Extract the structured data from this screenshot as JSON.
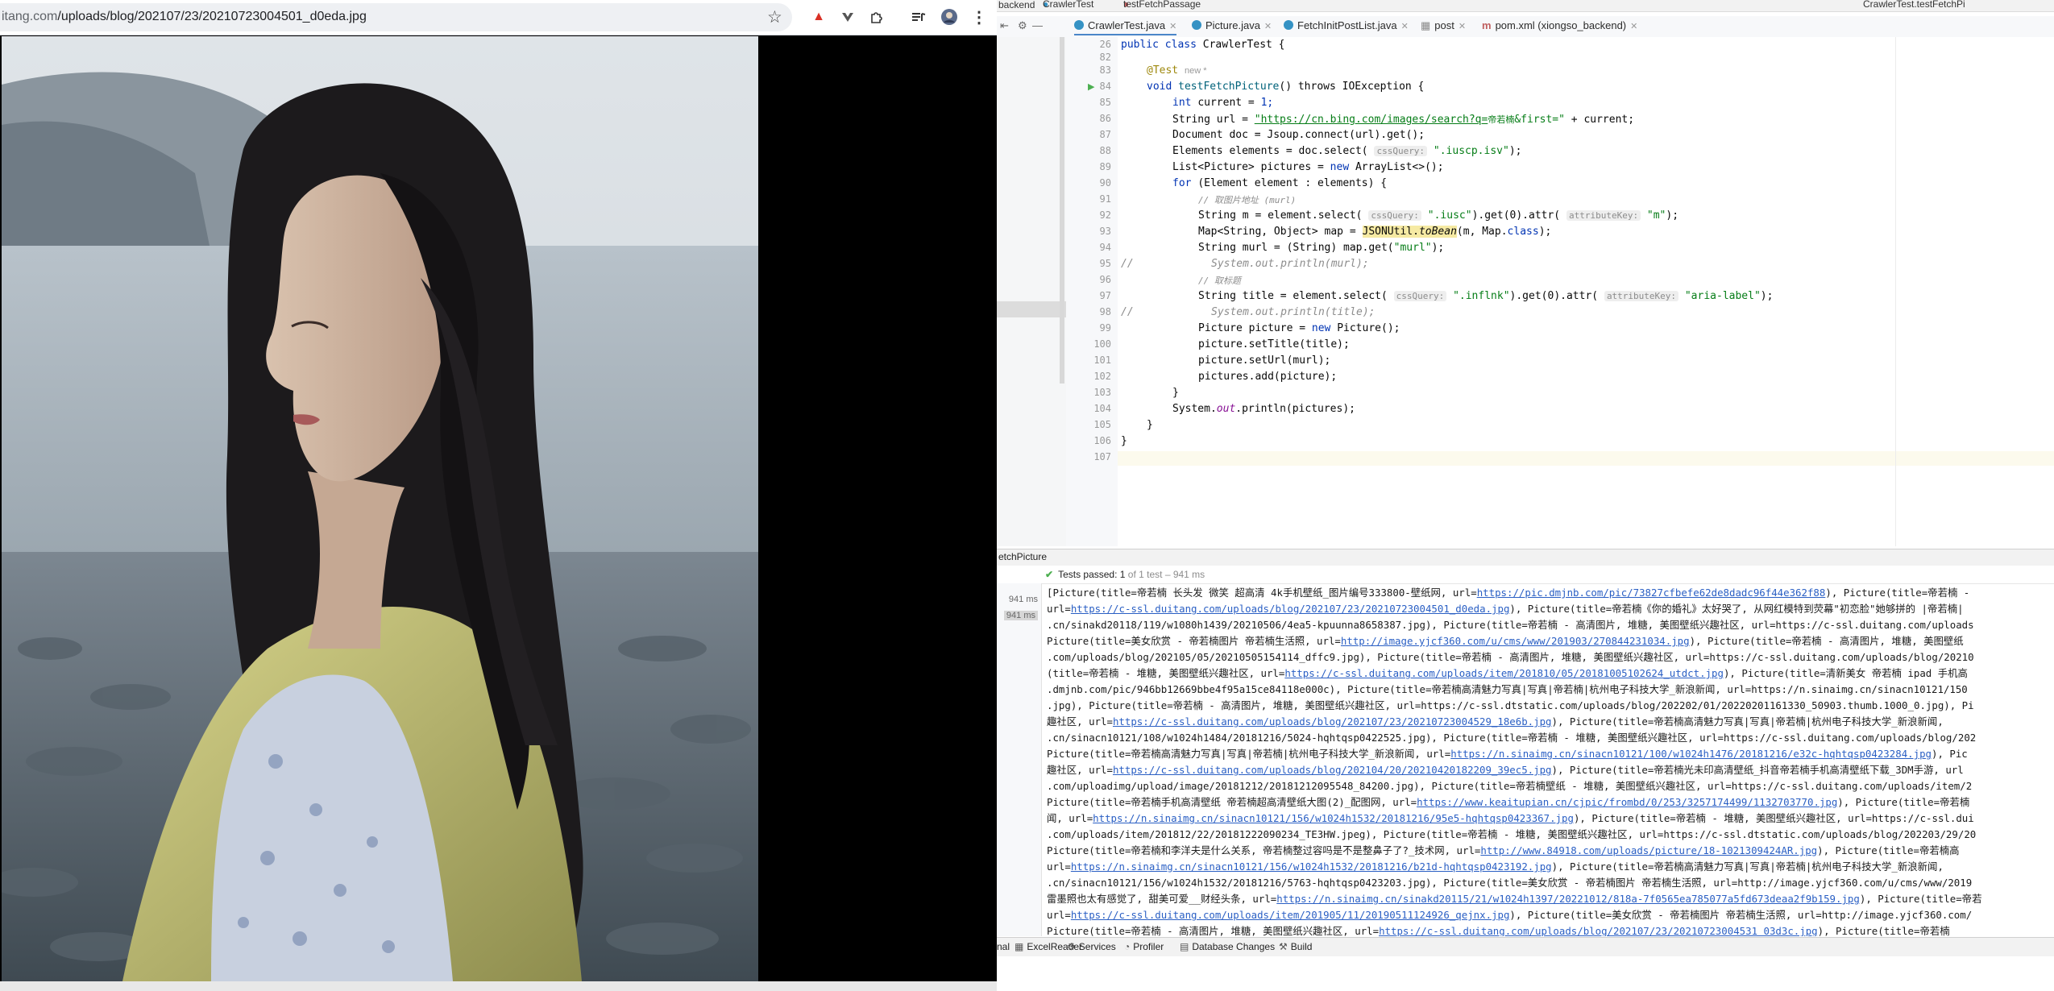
{
  "browser": {
    "url_host": "itang.com",
    "url_path": "/uploads/blog/202107/23/20210723004501_d0eda.jpg",
    "icons": [
      "bookmark-star-icon",
      "ext-red-icon",
      "ext-shield-icon",
      "extensions-puzzle-icon",
      "media-control-icon",
      "profile-avatar-icon",
      "more-menu-icon"
    ]
  },
  "ide": {
    "top_crumbs": [
      "backend",
      "CrawlerTest",
      "testFetchPassage",
      "CrawlerTest.testFetchPi"
    ],
    "tabs": [
      {
        "label": "CrawlerTest.java",
        "active": true,
        "color": "#3592c4"
      },
      {
        "label": "Picture.java",
        "active": false,
        "color": "#3592c4"
      },
      {
        "label": "FetchInitPostList.java",
        "active": false,
        "color": "#3592c4"
      },
      {
        "label": "post",
        "active": false,
        "color": "#8a8a8a"
      },
      {
        "label": "pom.xml (xiongso_backend)",
        "active": false,
        "color": "#c06060"
      }
    ],
    "line_numbers": [
      "26",
      "82",
      "83",
      "84",
      "85",
      "86",
      "87",
      "88",
      "89",
      "90",
      "91",
      "92",
      "93",
      "94",
      "95",
      "96",
      "97",
      "98",
      "99",
      "100",
      "101",
      "102",
      "103",
      "104",
      "105",
      "106",
      "107"
    ],
    "code_text": {
      "l26_a": "public class ",
      "l26_b": "CrawlerTest {",
      "l83_ann": "@Test",
      "l83_new": "new *",
      "l84_a": "void ",
      "l84_b": "testFetchPicture",
      "l84_c": "() throws IOException {",
      "l85_a": "int ",
      "l85_b": "current = ",
      "l85_c": "1;",
      "l86_a": "String url = ",
      "l86_b": "\"https://cn.bing.com/images/search?q=",
      "l86_c": "帝若楠",
      "l86_d": "&first=\"",
      "l86_e": " + current;",
      "l87": "Document doc = Jsoup.connect(url).get();",
      "l88_a": "Elements elements = doc.select( ",
      "l88_h": "cssQuery:",
      "l88_s": "\".iuscp.isv\"",
      "l88_e": ");",
      "l89_a": "List<Picture> pictures = ",
      "l89_k": "new ",
      "l89_b": "ArrayList<>();",
      "l90_k": "for ",
      "l90_b": "(Element element : elements) {",
      "l91": "// 取图片地址 (murl)",
      "l92_a": "String m = element.select( ",
      "l92_h": "cssQuery:",
      "l92_s": "\".iusc\"",
      "l92_b": ").get(0).attr( ",
      "l92_h2": "attributeKey:",
      "l92_s2": "\"m\"",
      "l92_e": ");",
      "l93_a": "Map<String, Object> map = ",
      "l93_hl": "JSONUtil.",
      "l93_st": "toBean",
      "l93_b": "(m, Map.",
      "l93_k": "class",
      "l93_e": ");",
      "l94_a": "String murl = (String) map.get(",
      "l94_s": "\"murl\"",
      "l94_e": ");",
      "l95_c": "//",
      "l95_b": "System.out.println(murl);",
      "l96": "// 取标题",
      "l97_a": "String title = element.select( ",
      "l97_h": "cssQuery:",
      "l97_s": "\".inflnk\"",
      "l97_b": ").get(0).attr( ",
      "l97_h2": "attributeKey:",
      "l97_s2": "\"aria-label\"",
      "l97_e": ");",
      "l98_c": "//",
      "l98_b": "System.out.println(title);",
      "l99_a": "Picture picture = ",
      "l99_k": "new ",
      "l99_b": "Picture();",
      "l100": "picture.setTitle(title);",
      "l101": "picture.setUrl(murl);",
      "l102": "pictures.add(picture);",
      "l103": "}",
      "l104_a": "System.",
      "l104_f": "out",
      "l104_b": ".println(pictures);",
      "l105": "}",
      "l106": "}"
    },
    "run_panel": {
      "title": "etchPicture",
      "pass_text": "Tests passed: 1",
      "pass_detail": " of 1 test – 941 ms",
      "times": [
        "941 ms",
        "941 ms"
      ]
    },
    "console_lines": [
      {
        "pre": "[Picture(title=帝若楠 长头发 微笑 超高清 4k手机壁纸_图片编号333800-壁纸网, url=",
        "link": "https://pic.dmjnb.com/pic/73827cfbefe62de8dadc96f44e362f88",
        "post": "), Picture(title=帝若楠 -"
      },
      {
        "pre": "url=",
        "link": "https://c-ssl.duitang.com/uploads/blog/202107/23/20210723004501_d0eda.jpg",
        "post": "), Picture(title=帝若楠《你的婚礼》太好哭了, 从网红模特到荧幕\"初恋脸\"她够拼的 |帝若楠|"
      },
      {
        "pre": ".cn/sinakd20118/119/w1080h1439/20210506/4ea5-kpuunna8658387.jpg",
        "link": "",
        "post": "), Picture(title=帝若楠 - 高清图片, 堆糖, 美图壁纸兴趣社区, url=https://c-ssl.duitang.com/uploads"
      },
      {
        "pre": "Picture(title=美女欣赏 - 帝若楠图片 帝若楠生活照, url=",
        "link": "http://image.yjcf360.com/u/cms/www/201903/270844231034.jpg",
        "post": "), Picture(title=帝若楠 - 高清图片, 堆糖, 美图壁纸"
      },
      {
        "pre": ".com/uploads/blog/202105/05/20210505154114_dffc9.jpg",
        "link": "",
        "post": "), Picture(title=帝若楠 - 高清图片, 堆糖, 美图壁纸兴趣社区, url=https://c-ssl.duitang.com/uploads/blog/20210"
      },
      {
        "pre": "(title=帝若楠 - 堆糖, 美图壁纸兴趣社区, url=",
        "link": "https://c-ssl.duitang.com/uploads/item/201810/05/20181005102624_utdct.jpg",
        "post": "), Picture(title=清新美女 帝若楠 ipad 手机高"
      },
      {
        "pre": ".dmjnb.com/pic/946bb12669bbe4f95a15ce84118e000c",
        "link": "",
        "post": "), Picture(title=帝若楠高清魅力写真|写真|帝若楠|杭州电子科技大学_新浪新闻, url=https://n.sinaimg.cn/sinacn10121/150"
      },
      {
        "pre": ".jpg",
        "link": "",
        "post": "), Picture(title=帝若楠 - 高清图片, 堆糖, 美图壁纸兴趣社区, url=https://c-ssl.dtstatic.com/uploads/blog/202202/01/20220201161330_50903.thumb.1000_0.jpg), Pi"
      },
      {
        "pre": "趣社区, url=",
        "link": "https://c-ssl.duitang.com/uploads/blog/202107/23/20210723004529_18e6b.jpg",
        "post": "), Picture(title=帝若楠高清魅力写真|写真|帝若楠|杭州电子科技大学_新浪新闻,"
      },
      {
        "pre": ".cn/sinacn10121/108/w1024h1484/20181216/5024-hqhtqsp0422525.jpg",
        "link": "",
        "post": "), Picture(title=帝若楠 - 堆糖, 美图壁纸兴趣社区, url=https://c-ssl.duitang.com/uploads/blog/202"
      },
      {
        "pre": "Picture(title=帝若楠高清魅力写真|写真|帝若楠|杭州电子科技大学_新浪新闻, url=",
        "link": "https://n.sinaimg.cn/sinacn10121/100/w1024h1476/20181216/e32c-hqhtqsp0423284.jpg",
        "post": "), Pic"
      },
      {
        "pre": "趣社区, url=",
        "link": "https://c-ssl.duitang.com/uploads/blog/202104/20/20210420182209_39ec5.jpg",
        "post": "), Picture(title=帝若楠光未印高清壁纸_抖音帝若楠手机高清壁纸下载_3DM手游, url"
      },
      {
        "pre": ".com/uploadimg/upload/image/20181212/20181212095548_84200.jpg",
        "link": "",
        "post": "), Picture(title=帝若楠壁纸 - 堆糖, 美图壁纸兴趣社区, url=https://c-ssl.duitang.com/uploads/item/2"
      },
      {
        "pre": "Picture(title=帝若楠手机高清壁纸 帝若楠超高清壁纸大图(2)_配图网, url=",
        "link": "https://www.keaitupian.cn/cjpic/frombd/0/253/3257174499/1132703770.jpg",
        "post": "), Picture(title=帝若楠"
      },
      {
        "pre": "闻, url=",
        "link": "https://n.sinaimg.cn/sinacn10121/156/w1024h1532/20181216/95e5-hqhtqsp0423367.jpg",
        "post": "), Picture(title=帝若楠 - 堆糖, 美图壁纸兴趣社区, url=https://c-ssl.dui"
      },
      {
        "pre": ".com/uploads/item/201812/22/20181222090234_TE3HW.jpeg",
        "link": "",
        "post": "), Picture(title=帝若楠 - 堆糖, 美图壁纸兴趣社区, url=https://c-ssl.dtstatic.com/uploads/blog/202203/29/20"
      },
      {
        "pre": "Picture(title=帝若楠和李洋夫是什么关系, 帝若楠整过容吗是不是整鼻子了?_技术网, url=",
        "link": "http://www.84918.com/uploads/picture/18-1021309424AR.jpg",
        "post": "), Picture(title=帝若楠高"
      },
      {
        "pre": "url=",
        "link": "https://n.sinaimg.cn/sinacn10121/156/w1024h1532/20181216/b21d-hqhtqsp0423192.jpg",
        "post": "), Picture(title=帝若楠高清魅力写真|写真|帝若楠|杭州电子科技大学_新浪新闻,"
      },
      {
        "pre": ".cn/sinacn10121/156/w1024h1532/20181216/5763-hqhtqsp0423203.jpg",
        "link": "",
        "post": "), Picture(title=美女欣赏 - 帝若楠图片 帝若楠生活照, url=http://image.yjcf360.com/u/cms/www/2019"
      },
      {
        "pre": "雷墨照也太有感觉了, 甜美可爱__财经头条, url=",
        "link": "https://n.sinaimg.cn/sinakd20115/21/w1024h1397/20221012/818a-7f0565ea785077a5fd673deaa2f9b159.jpg",
        "post": "), Picture(title=帝若"
      },
      {
        "pre": "url=",
        "link": "https://c-ssl.duitang.com/uploads/item/201905/11/20190511124926_qejnx.jpg",
        "post": "), Picture(title=美女欣赏 - 帝若楠图片 帝若楠生活照, url=http://image.yjcf360.com/"
      },
      {
        "pre": "Picture(title=帝若楠 - 高清图片, 堆糖, 美图壁纸兴趣社区, url=",
        "link": "https://c-ssl.duitang.com/uploads/blog/202107/23/20210723004531_03d3c.jpg",
        "post": "), Picture(title=帝若楠"
      }
    ],
    "status": {
      "items": [
        "nal",
        "ExcelReader",
        "Services",
        "Profiler",
        "Database Changes",
        "Build"
      ]
    }
  }
}
